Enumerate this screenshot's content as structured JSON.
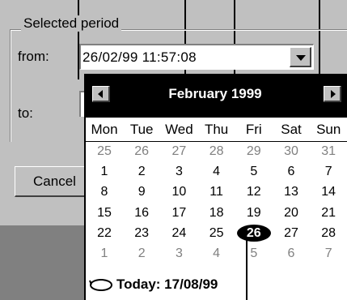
{
  "group": {
    "title": "Selected period"
  },
  "form": {
    "from_label": "from:",
    "from_value": "26/02/99 11:57:08",
    "to_label": "to:"
  },
  "buttons": {
    "cancel_label": "Cancel"
  },
  "calendar": {
    "month_title": "February 1999",
    "weekdays": [
      "Mon",
      "Tue",
      "Wed",
      "Thu",
      "Fri",
      "Sat",
      "Sun"
    ],
    "weeks": [
      [
        "25",
        "26",
        "27",
        "28",
        "29",
        "30",
        "31"
      ],
      [
        "1",
        "2",
        "3",
        "4",
        "5",
        "6",
        "7"
      ],
      [
        "8",
        "9",
        "10",
        "11",
        "12",
        "13",
        "14"
      ],
      [
        "15",
        "16",
        "17",
        "18",
        "19",
        "20",
        "21"
      ],
      [
        "22",
        "23",
        "24",
        "25",
        "26",
        "27",
        "28"
      ],
      [
        "1",
        "2",
        "3",
        "4",
        "5",
        "6",
        "7"
      ]
    ],
    "muted_weeks": [
      0,
      5
    ],
    "selected_day": "26",
    "today_text": "Today: 17/08/99"
  }
}
